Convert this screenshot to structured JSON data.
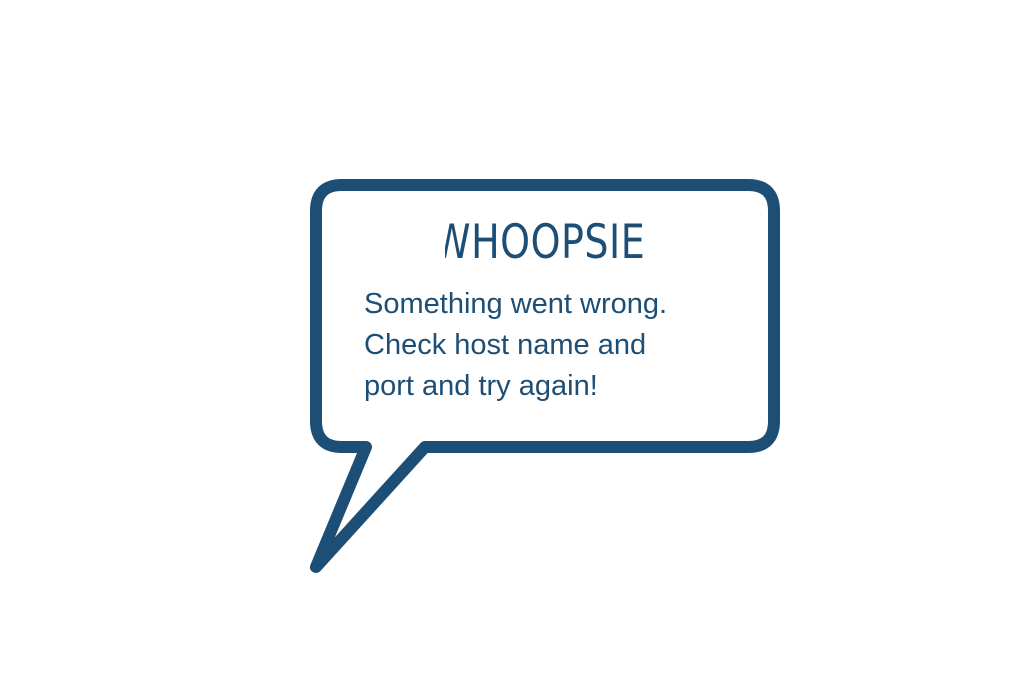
{
  "colors": {
    "accent": "#1d4e75",
    "background": "#ffffff"
  },
  "error": {
    "title": "WHOOPSIE!",
    "message_lines": [
      "Something went wrong.",
      "Check host name and",
      "port and try again!"
    ]
  },
  "icons": {
    "bubble": "speech-bubble-icon"
  }
}
